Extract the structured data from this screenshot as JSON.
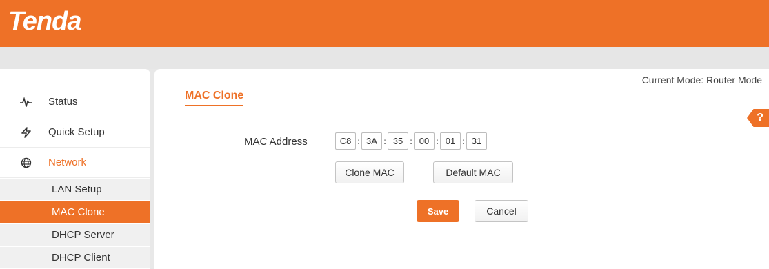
{
  "brand": {
    "logo_text": "Tenda",
    "accent": "#ee7127"
  },
  "sidebar": {
    "items": [
      {
        "label": "Status",
        "icon": "pulse-icon"
      },
      {
        "label": "Quick Setup",
        "icon": "lightning-icon"
      },
      {
        "label": "Network",
        "icon": "globe-icon",
        "active": true
      }
    ],
    "subitems": [
      {
        "label": "LAN Setup"
      },
      {
        "label": "MAC Clone",
        "selected": true
      },
      {
        "label": "DHCP Server"
      },
      {
        "label": "DHCP Client"
      }
    ]
  },
  "header": {
    "current_mode": "Current Mode: Router Mode"
  },
  "page": {
    "title": "MAC Clone",
    "help_label": "?",
    "mac_label": "MAC Address",
    "mac_octets": [
      "C8",
      "3A",
      "35",
      "00",
      "01",
      "31"
    ],
    "mac_separator": ":",
    "clone_button": "Clone MAC",
    "default_button": "Default MAC",
    "save_button": "Save",
    "cancel_button": "Cancel"
  }
}
